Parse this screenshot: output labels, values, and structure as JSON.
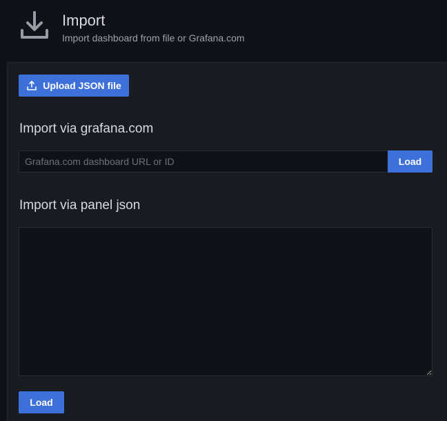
{
  "header": {
    "icon": "download-icon",
    "title": "Import",
    "subtitle": "Import dashboard from file or Grafana.com"
  },
  "upload": {
    "icon": "upload-icon",
    "label": "Upload JSON file"
  },
  "grafana_com": {
    "title": "Import via grafana.com",
    "input_value": "",
    "input_placeholder": "Grafana.com dashboard URL or ID",
    "load_label": "Load"
  },
  "panel_json": {
    "title": "Import via panel json",
    "textarea_value": "",
    "load_label": "Load"
  },
  "colors": {
    "background": "#111217",
    "panel": "#181b1f",
    "primary": "#3d71d9",
    "text": "#d8d9e3",
    "muted": "#9fa1ad"
  }
}
